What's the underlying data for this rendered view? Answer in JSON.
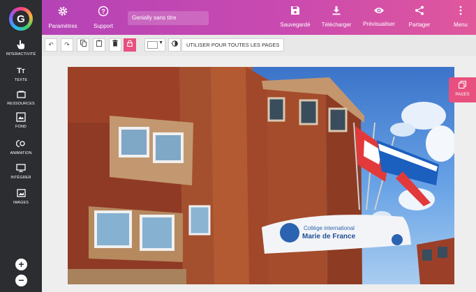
{
  "app": {
    "logo_letter": "G"
  },
  "sidebar": {
    "items": [
      {
        "label": "INTERACTIVITÉ",
        "icon": "hand-pointer-icon"
      },
      {
        "label": "TEXTE",
        "icon": "text-icon"
      },
      {
        "label": "RESSOURCES",
        "icon": "resources-icon"
      },
      {
        "label": "FOND",
        "icon": "background-icon"
      },
      {
        "label": "ANIMATION",
        "icon": "animation-icon"
      },
      {
        "label": "INTÉGRER",
        "icon": "embed-icon"
      },
      {
        "label": "IMAGES",
        "icon": "image-icon"
      }
    ],
    "zoom_in": "+",
    "zoom_out": "−"
  },
  "header": {
    "settings_label": "Paramètres",
    "support_label": "Support",
    "title_value": "Genially sans titre",
    "saved_label": "Sauvegardé",
    "download_label": "Télécharger",
    "preview_label": "Prévisualiser",
    "share_label": "Partager",
    "menu_label": "Menu"
  },
  "toolbar": {
    "apply_all_label": "UTILISER POUR TOUTES LES PAGES"
  },
  "canvas": {
    "college_line1": "Collège international",
    "college_line2": "Marie de France"
  },
  "pages_panel": {
    "label": "PAGES"
  },
  "colors": {
    "header_gradient_start": "#b543b6",
    "header_gradient_end": "#e0579c",
    "accent": "#e7507f",
    "sidebar_bg": "#2b2d31"
  }
}
